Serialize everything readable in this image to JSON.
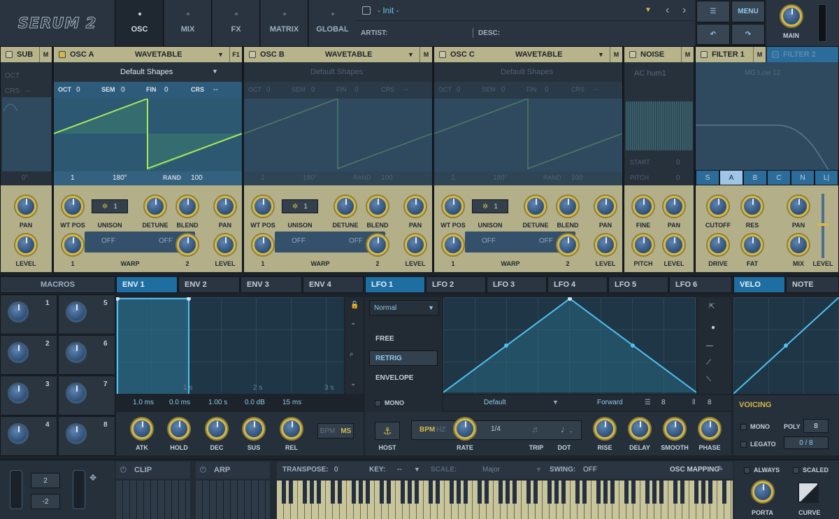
{
  "header": {
    "logo": "SERUM 2",
    "tabs": [
      "OSC",
      "MIX",
      "FX",
      "MATRIX",
      "GLOBAL"
    ],
    "active_tab": "OSC",
    "preset_name": "- Init -",
    "artist_label": "ARTIST:",
    "desc_label": "DESC:",
    "menu_label": "MENU",
    "main_label": "MAIN"
  },
  "osc": {
    "sub": {
      "title": "SUB",
      "m": "M",
      "oct": "OCT",
      "crs": "CRS",
      "crs_val": "--",
      "phase": "0°",
      "label_pan": "PAN",
      "label_level": "LEVEL"
    },
    "a": {
      "title": "OSC A",
      "type": "WAVETABLE",
      "f1": "F1",
      "table": "Default Shapes",
      "oct": "OCT",
      "oct_v": "0",
      "sem": "SEM",
      "sem_v": "0",
      "fin": "FIN",
      "fin_v": "0",
      "crs": "CRS",
      "crs_v": "--",
      "frame": "1",
      "phase": "180°",
      "rand_label": "RAND",
      "rand": "100",
      "unison": "1",
      "labels": [
        "WT POS",
        "UNISON",
        "DETUNE",
        "BLEND",
        "PAN",
        "LEVEL",
        "WARP"
      ],
      "warp1": "OFF",
      "warp2": "OFF",
      "w1": "1",
      "w2": "2"
    },
    "b": {
      "title": "OSC B",
      "type": "WAVETABLE",
      "m": "M",
      "table": "Default Shapes",
      "oct": "OCT",
      "oct_v": "0",
      "sem": "SEM",
      "sem_v": "0",
      "fin": "FIN",
      "fin_v": "0",
      "crs": "CRS",
      "crs_v": "--",
      "frame": "1",
      "phase": "180°",
      "rand_label": "RAND",
      "rand": "100",
      "unison": "1",
      "warp1": "OFF",
      "warp2": "OFF",
      "w1": "1",
      "w2": "2"
    },
    "c": {
      "title": "OSC C",
      "type": "WAVETABLE",
      "m": "M",
      "table": "Default Shapes",
      "oct": "OCT",
      "oct_v": "0",
      "sem": "SEM",
      "sem_v": "0",
      "fin": "FIN",
      "fin_v": "0",
      "crs": "CRS",
      "crs_v": "--",
      "frame": "1",
      "phase": "180°",
      "rand_label": "RAND",
      "rand": "100",
      "unison": "1",
      "warp1": "OFF",
      "warp2": "OFF",
      "w1": "1",
      "w2": "2"
    },
    "noise": {
      "title": "NOISE",
      "m": "M",
      "sample": "AC hum1",
      "start": "START",
      "start_v": "0",
      "pitch": "PITCH",
      "pitch_v": "0",
      "labels": [
        "FINE",
        "PAN",
        "PITCH",
        "LEVEL"
      ]
    },
    "filter1": {
      "title": "FILTER 1",
      "m": "M",
      "type": "MG Low 12",
      "tabs": [
        "S",
        "A",
        "B",
        "C",
        "N",
        "L|"
      ],
      "labels": [
        "CUTOFF",
        "RES",
        "PAN",
        "DRIVE",
        "FAT",
        "MIX",
        "LEVEL"
      ]
    },
    "filter2": {
      "title": "FILTER 2"
    }
  },
  "mod": {
    "macros_title": "MACROS",
    "macros": [
      "1",
      "2",
      "3",
      "4",
      "5",
      "6",
      "7",
      "8"
    ],
    "env_tabs": [
      "ENV 1",
      "ENV 2",
      "ENV 3",
      "ENV 4"
    ],
    "env_values": [
      "1.0 ms",
      "0.0 ms",
      "1.00 s",
      "0.0 dB",
      "15 ms"
    ],
    "env_ticks": [
      "1 s",
      "2 s",
      "3 s"
    ],
    "env_knobs": [
      "ATK",
      "HOLD",
      "DEC",
      "SUS",
      "REL"
    ],
    "bpm": "BPM",
    "ms": "MS",
    "lfo_tabs": [
      "LFO 1",
      "LFO 2",
      "LFO 3",
      "LFO 4",
      "LFO 5",
      "LFO 6"
    ],
    "lfo_mode": "Normal",
    "lfo_opts": [
      "FREE",
      "RETRIG",
      "ENVELOPE"
    ],
    "mono": "MONO",
    "lfo_shape": "Default",
    "lfo_dir": "Forward",
    "lfo_grid1": "8",
    "lfo_grid2": "8",
    "lfo_host": "HOST",
    "lfo_bpm": "BPM",
    "lfo_hz": "HZ",
    "lfo_rate_val": "1/4",
    "lfo_knobs": [
      "RATE",
      "TRIP",
      "DOT",
      "RISE",
      "DELAY",
      "SMOOTH",
      "PHASE"
    ],
    "velo_tabs": [
      "VELO",
      "NOTE"
    ],
    "voicing": "VOICING",
    "v_mono": "MONO",
    "poly_label": "POLY",
    "poly": "8",
    "legato": "LEGATO",
    "voices": "0 / 8"
  },
  "bottom": {
    "oct": "2",
    "semi": "-2",
    "clip": "CLIP",
    "arp": "ARP",
    "transpose_label": "TRANSPOSE:",
    "transpose": "0",
    "key_label": "KEY:",
    "key": "--",
    "scale_label": "SCALE:",
    "scale": "Major",
    "swing_label": "SWING:",
    "swing": "OFF",
    "osc_mapping": "OSC MAPPING",
    "always": "ALWAYS",
    "scaled": "SCALED",
    "porta": "PORTA",
    "curve": "CURVE"
  }
}
